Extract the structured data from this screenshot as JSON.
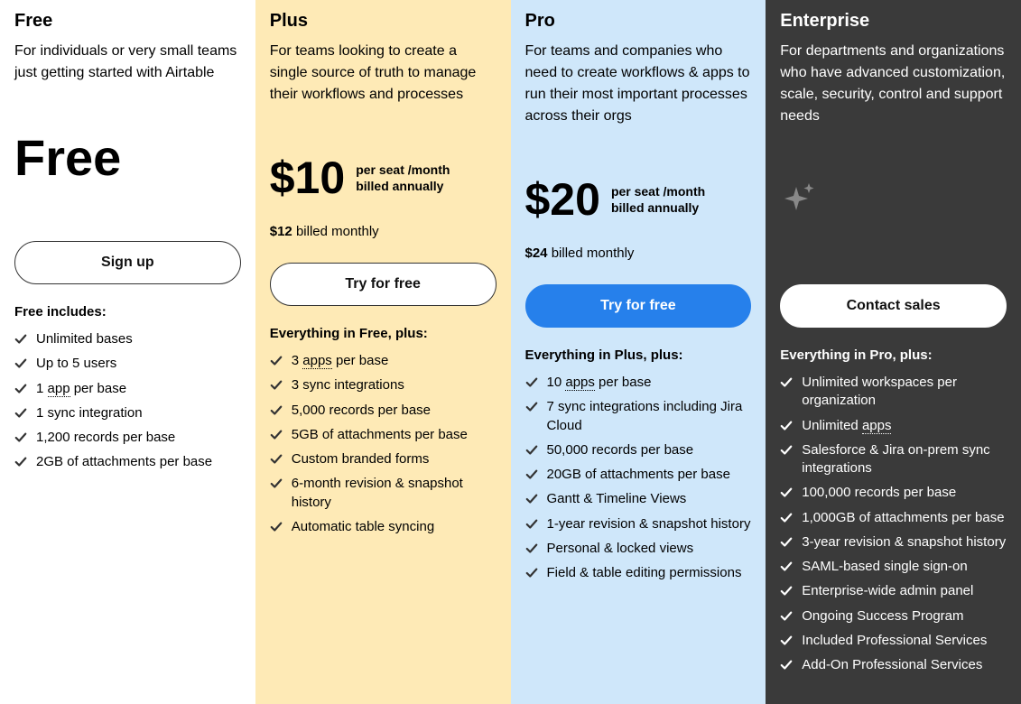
{
  "plans": {
    "free": {
      "name": "Free",
      "desc": "For individuals or very small teams just getting started with Airtable",
      "price_label": "Free",
      "cta": "Sign up",
      "features_header": "Free includes:",
      "features": [
        "Unlimited bases",
        "Up to 5 users",
        "1 app per base",
        "1 sync integration",
        "1,200 records per base",
        "2GB of attachments per base"
      ]
    },
    "plus": {
      "name": "Plus",
      "desc": "For teams looking to create a single source of truth to manage their workflows and processes",
      "price": "$10",
      "price_unit_line1": "per seat /month",
      "price_unit_line2": "billed annually",
      "alt_price_bold": "$12",
      "alt_price_rest": " billed monthly",
      "cta": "Try for free",
      "features_header": "Everything in Free, plus:",
      "features": [
        "3 apps per base",
        "3 sync integrations",
        "5,000 records per base",
        "5GB of attachments per base",
        "Custom branded forms",
        "6-month revision & snapshot history",
        "Automatic table syncing"
      ]
    },
    "pro": {
      "name": "Pro",
      "desc": "For teams and companies who need to create workflows & apps to run their most important processes across their orgs",
      "price": "$20",
      "price_unit_line1": "per seat /month",
      "price_unit_line2": "billed annually",
      "alt_price_bold": "$24",
      "alt_price_rest": " billed monthly",
      "cta": "Try for free",
      "features_header": "Everything in Plus, plus:",
      "features": [
        "10 apps per base",
        "7 sync integrations including Jira Cloud",
        "50,000 records per base",
        "20GB of attachments per base",
        "Gantt & Timeline Views",
        "1-year revision & snapshot history",
        "Personal & locked views",
        "Field & table editing permissions"
      ]
    },
    "enterprise": {
      "name": "Enterprise",
      "desc": "For departments and organizations who have advanced customization, scale, security, control and support needs",
      "cta": "Contact sales",
      "features_header": "Everything in Pro, plus:",
      "features": [
        "Unlimited workspaces per organization",
        "Unlimited apps",
        "Salesforce & Jira on-prem sync integrations",
        "100,000 records per base",
        "1,000GB of attachments per base",
        "3-year revision & snapshot history",
        "SAML-based single sign-on",
        "Enterprise-wide admin panel",
        "Ongoing Success Program",
        "Included Professional Services",
        "Add-On Professional Services"
      ]
    }
  }
}
